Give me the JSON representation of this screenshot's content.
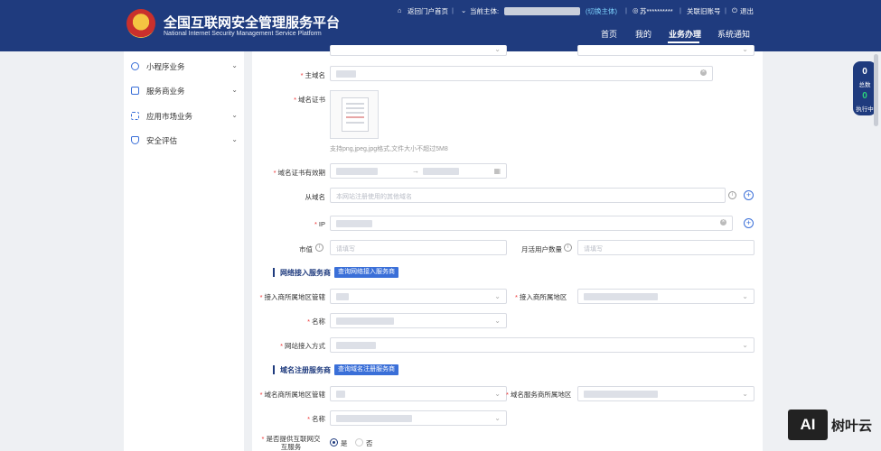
{
  "header": {
    "title_cn": "全国互联网安全管理服务平台",
    "title_en": "National Internet Security Management Service Platform",
    "back_portal": "返回门户首页",
    "current_entity_label": "当前主体:",
    "switch_entity": "(切换主体)",
    "username": "苏**********",
    "link_old_account": "关联旧账号",
    "logout": "退出",
    "nav": [
      "首页",
      "我的",
      "业务办理",
      "系统通知"
    ]
  },
  "sidebar": {
    "items": [
      {
        "label": "小程序业务",
        "icon": "compass-icon"
      },
      {
        "label": "服务商业务",
        "icon": "monitor-icon"
      },
      {
        "label": "应用市场业务",
        "icon": "grid-icon"
      },
      {
        "label": "安全评估",
        "icon": "shield-icon"
      }
    ]
  },
  "form": {
    "main_domain_label": "主域名",
    "domain_cert_label": "域名证书",
    "cert_hint": "支持png,jpeg,jpg格式,文件大小不超过5M8",
    "cert_validity_label": "域名证书有效期",
    "sub_domain_label": "从域名",
    "sub_domain_placeholder": "本网站注册使用的其他域名",
    "ip_label": "IP",
    "market_value_label": "市值",
    "market_value_placeholder": "请填写",
    "mau_label": "月活用户数量",
    "mau_placeholder": "请填写",
    "network_section": "网络接入服务商",
    "network_query_btn": "查询网络接入服务商",
    "access_region_mgmt_label": "接入商所属地区管辖",
    "access_region_label": "接入商所属地区",
    "access_name_label": "名称",
    "access_method_label": "网站接入方式",
    "registrar_section": "域名注册服务商",
    "registrar_query_btn": "查询域名注册服务商",
    "registrar_region_mgmt_label": "域名商所属地区管辖",
    "registrar_region_label": "域名服务商所属地区",
    "registrar_name_label": "名称",
    "interactive_label": "是否提供互联网交互服务",
    "yes": "是",
    "no": "否",
    "date_separator": "→"
  },
  "float_panel": {
    "total_count": "0",
    "total_label": "总数",
    "running_count": "0",
    "running_label": "执行中"
  },
  "watermark": {
    "logo_text": "AI",
    "brand": "树叶云"
  }
}
